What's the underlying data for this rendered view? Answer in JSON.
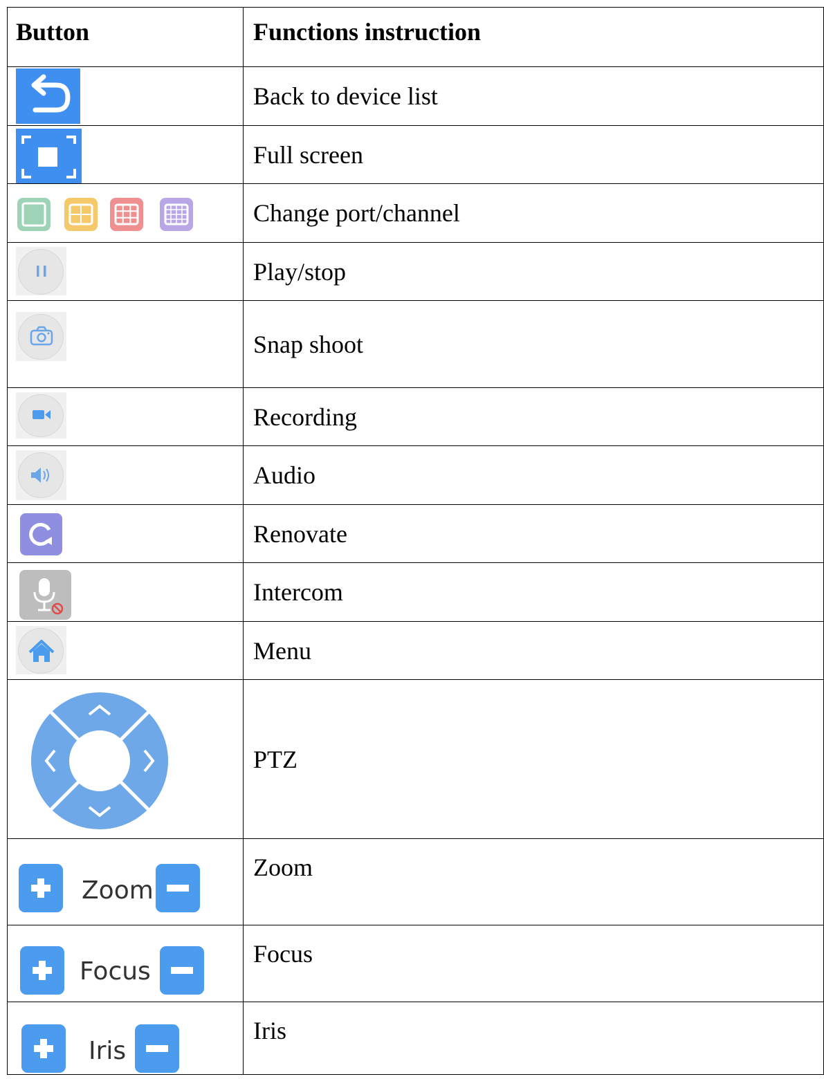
{
  "headers": {
    "button": "Button",
    "functions": "Functions instruction"
  },
  "rows": [
    {
      "icon": "back-arrow-icon",
      "label": "Back to device list"
    },
    {
      "icon": "fullscreen-icon",
      "label": "Full screen"
    },
    {
      "icon": "layout-grid-icons",
      "label": "Change port/channel"
    },
    {
      "icon": "pause-icon",
      "label": "Play/stop"
    },
    {
      "icon": "camera-icon",
      "label": "Snap shoot"
    },
    {
      "icon": "video-camera-icon",
      "label": "Recording"
    },
    {
      "icon": "speaker-icon",
      "label": "Audio"
    },
    {
      "icon": "refresh-icon",
      "label": "Renovate"
    },
    {
      "icon": "microphone-muted-icon",
      "label": "Intercom"
    },
    {
      "icon": "home-icon",
      "label": "Menu"
    },
    {
      "icon": "ptz-dpad-icon",
      "label": "PTZ"
    },
    {
      "icon": "plus-minus-icon",
      "label": "Zoom",
      "control_label": "Zoom"
    },
    {
      "icon": "plus-minus-icon",
      "label": "Focus",
      "control_label": "Focus"
    },
    {
      "icon": "plus-minus-icon",
      "label": "Iris",
      "control_label": "Iris"
    }
  ],
  "colors": {
    "blue": "#3f8ff0",
    "light_blue": "#4b9cef",
    "green": "#9fd3b8",
    "yellow": "#f5c86a",
    "red": "#ef8f8f",
    "purple": "#b9a6e6",
    "renovate_purple": "#8f8ee0",
    "ptz_blue": "#6fa8e8"
  }
}
